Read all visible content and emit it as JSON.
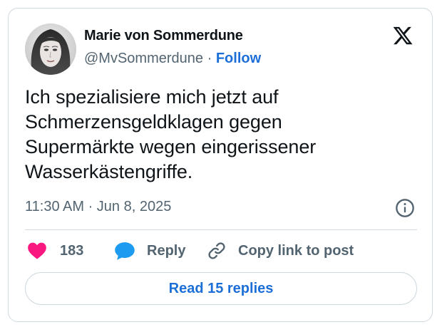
{
  "author": {
    "name": "Marie von Sommerdune",
    "handle": "@MvSommerdune",
    "separator": "·",
    "follow_label": "Follow"
  },
  "tweet": {
    "text": "Ich spezialisiere mich jetzt auf\nSchmerzensgeldklagen gegen\nSupermärkte wegen eingerissener\nWasserkästengriffe.",
    "timestamp": "11:30 AM · Jun 8, 2025"
  },
  "actions": {
    "like_count": "183",
    "reply_label": "Reply",
    "copy_link_label": "Copy link to post"
  },
  "read_replies_label": "Read 15 replies",
  "icons": {
    "logo": "x-logo-icon",
    "info": "info-icon",
    "like": "heart-icon",
    "reply": "speech-bubble-icon",
    "copy": "link-icon"
  },
  "colors": {
    "like": "#f91880",
    "reply": "#1d9bf0",
    "link": "#1d6fd8",
    "secondary_text": "#536471",
    "border": "#cfd9de"
  }
}
